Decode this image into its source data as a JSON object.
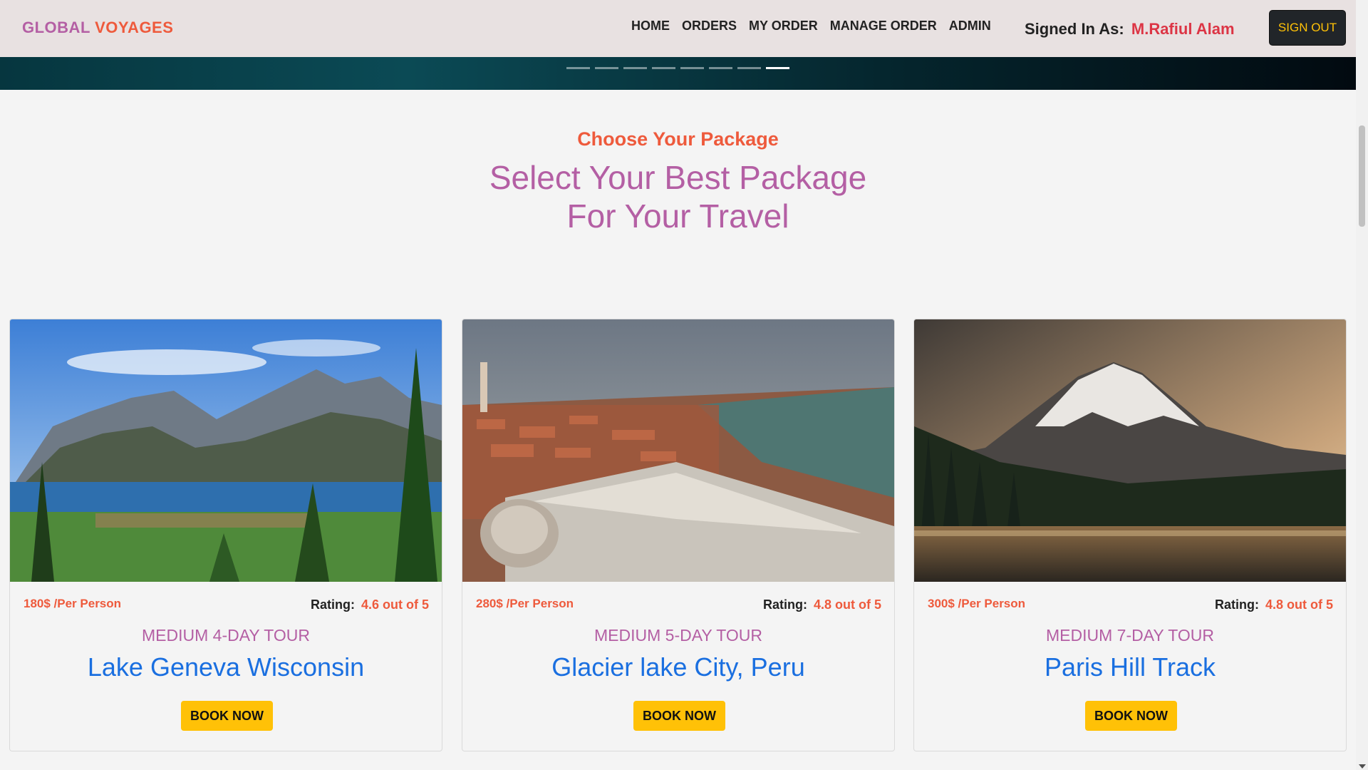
{
  "brand": {
    "part1": "GLOBAL",
    "part2": "VOYAGES"
  },
  "nav": {
    "links": [
      "HOME",
      "ORDERS",
      "MY ORDER",
      "MANAGE ORDER",
      "ADMIN"
    ]
  },
  "user": {
    "signed_in_label": "Signed In As:",
    "name": "M.Rafiul Alam",
    "sign_out_label": "SIGN OUT"
  },
  "carousel": {
    "indicator_count": 8,
    "active_index": 7
  },
  "section": {
    "kicker": "Choose Your Package",
    "title_line1": "Select Your Best Package",
    "title_line2": "For Your Travel"
  },
  "packages": [
    {
      "price": "180$ /Per Person",
      "rating_label": "Rating:",
      "rating_value": "4.6 out of 5",
      "tour_type": "MEDIUM 4-DAY TOUR",
      "name": "Lake Geneva Wisconsin",
      "button": "BOOK NOW",
      "image": "mountain-lake-photo"
    },
    {
      "price": "280$ /Per Person",
      "rating_label": "Rating:",
      "rating_value": "4.8 out of 5",
      "tour_type": "MEDIUM 5-DAY TOUR",
      "name": "Glacier lake City, Peru",
      "button": "BOOK NOW",
      "image": "city-aerial-photo"
    },
    {
      "price": "300$ /Per Person",
      "rating_label": "Rating:",
      "rating_value": "4.8 out of 5",
      "tour_type": "MEDIUM 7-DAY TOUR",
      "name": "Paris Hill Track",
      "button": "BOOK NOW",
      "image": "snow-volcano-photo"
    }
  ],
  "colors": {
    "accent_purple": "#b45fa4",
    "accent_orange": "#ee5a3c",
    "link_blue": "#1a6fe0",
    "button_yellow": "#ffc107",
    "dark": "#212529"
  }
}
